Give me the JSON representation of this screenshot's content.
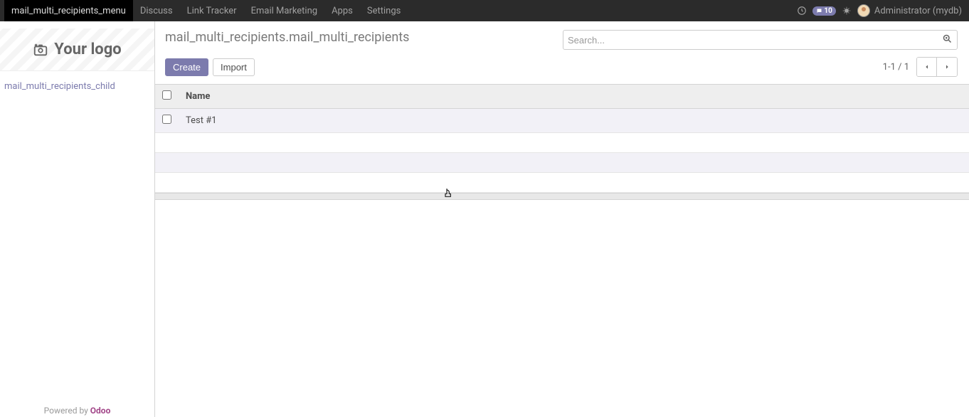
{
  "navbar": {
    "active_item": "mail_multi_recipients_menu",
    "items": [
      "Discuss",
      "Link Tracker",
      "Email Marketing",
      "Apps",
      "Settings"
    ],
    "message_count": "10",
    "user_label": "Administrator (mydb)"
  },
  "sidebar": {
    "logo_text": "Your logo",
    "menu_item": "mail_multi_recipients_child",
    "footer_prefix": "Powered by ",
    "footer_brand": "Odoo"
  },
  "header": {
    "breadcrumb": "mail_multi_recipients.mail_multi_recipients",
    "search_placeholder": "Search..."
  },
  "controls": {
    "create_label": "Create",
    "import_label": "Import",
    "pager_info": "1-1 / 1"
  },
  "table": {
    "header_name": "Name",
    "rows": [
      {
        "name": "Test #1"
      }
    ]
  }
}
